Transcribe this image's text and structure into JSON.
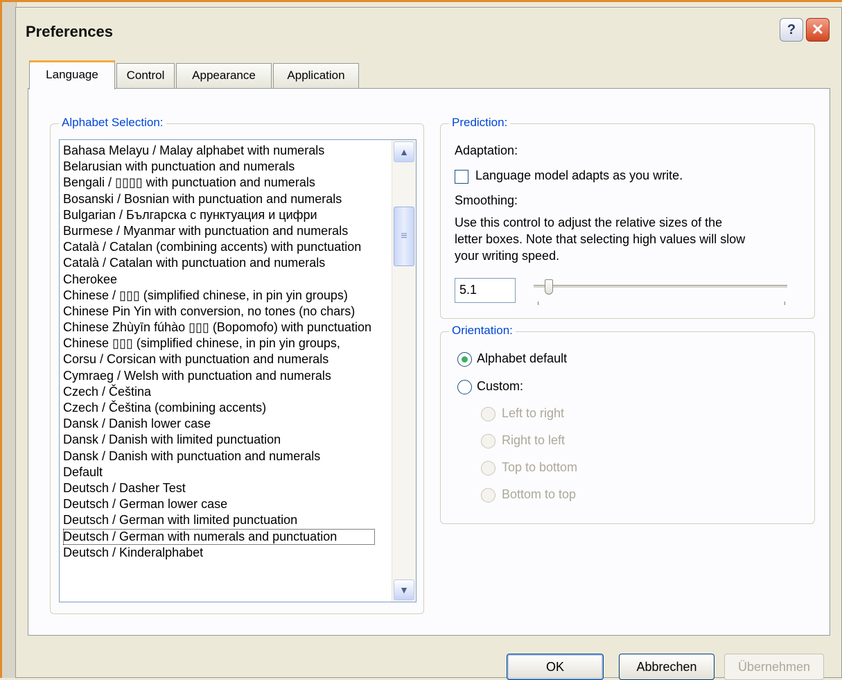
{
  "dialog": {
    "title": "Preferences",
    "help_glyph": "?",
    "close_glyph": "✕"
  },
  "tabs": [
    {
      "label": "Language",
      "active": true
    },
    {
      "label": "Control",
      "active": false
    },
    {
      "label": "Appearance",
      "active": false
    },
    {
      "label": "Application",
      "active": false
    }
  ],
  "alphabet": {
    "legend": "Alphabet Selection:",
    "items": [
      "Bahasa Melayu / Malay alphabet with numerals",
      "Belarusian with punctuation and numerals",
      "Bengali / ▯▯▯▯   with punctuation and numerals",
      "Bosanski / Bosnian with punctuation and numerals",
      "Bulgarian / Българска с пунктуация и цифри",
      "Burmese / Myanmar with punctuation and numerals",
      "Català / Catalan (combining accents) with punctuation",
      "Català / Catalan with punctuation and numerals",
      "Cherokee",
      "Chinese / ▯▯▯ (simplified chinese, in pin yin groups)",
      "Chinese Pin Yin with conversion, no tones (no chars)",
      "Chinese Zhùyīn fúhào  ▯▯▯ (Bopomofo) with punctuation",
      "Chinese ▯▯▯ (simplified chinese, in pin yin groups,",
      "Corsu / Corsican with punctuation and numerals",
      "Cymraeg / Welsh with punctuation and numerals",
      "Czech / Čeština",
      "Czech / Čeština (combining accents)",
      "Dansk / Danish lower case",
      "Dansk / Danish with limited punctuation",
      "Dansk / Danish with punctuation and numerals",
      "Default",
      "Deutsch / Dasher Test",
      "Deutsch / German lower case",
      "Deutsch / German with limited punctuation",
      "Deutsch / German with numerals and punctuation",
      "Deutsch / Kinderalphabet"
    ],
    "selected_index": 24,
    "scroll_up": "▲",
    "scroll_down": "▼",
    "thumb_grip": "≡"
  },
  "prediction": {
    "legend": "Prediction:",
    "adaptation_label": "Adaptation:",
    "adapt_checkbox_label": "Language model adapts as you write.",
    "adapt_checked": false,
    "smoothing_label": "Smoothing:",
    "smoothing_description_line1": "Use this control to adjust the relative sizes of the",
    "smoothing_description_line2": "letter boxes. Note that selecting high values will slow",
    "smoothing_description_line3": "your writing speed.",
    "smoothing_value": "5.1"
  },
  "orientation": {
    "legend": "Orientation:",
    "options": [
      {
        "label": "Alphabet default",
        "checked": true,
        "enabled": true
      },
      {
        "label": "Custom:",
        "checked": false,
        "enabled": true
      },
      {
        "label": "Left to right",
        "checked": false,
        "enabled": false
      },
      {
        "label": "Right to left",
        "checked": false,
        "enabled": false
      },
      {
        "label": "Top to bottom",
        "checked": false,
        "enabled": false
      },
      {
        "label": "Bottom to top",
        "checked": false,
        "enabled": false
      }
    ]
  },
  "buttons": {
    "ok": "OK",
    "cancel": "Abbrechen",
    "apply": "Übernehmen"
  }
}
